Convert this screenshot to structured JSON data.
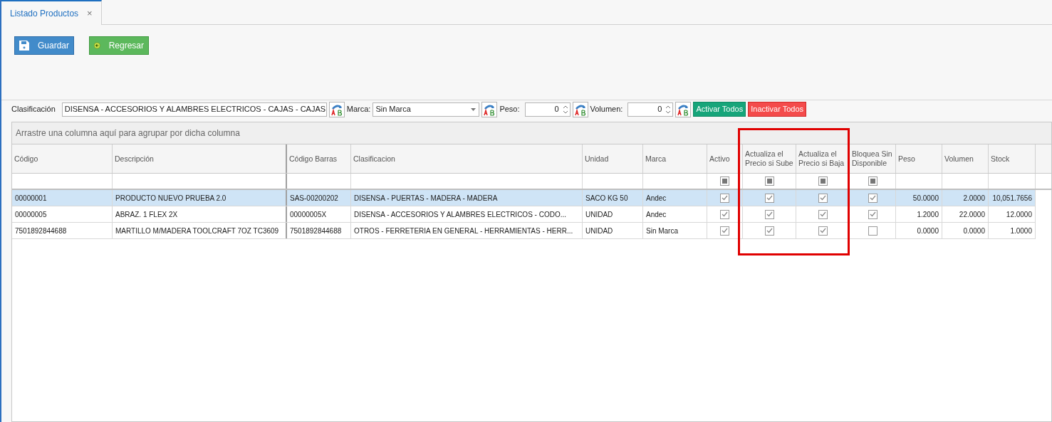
{
  "tabs": [
    {
      "label": "Listado Productos",
      "selected": true,
      "close": "×"
    }
  ],
  "toolbar": [
    {
      "label": "Guardar",
      "kind": "save"
    },
    {
      "label": "Regresar",
      "kind": "back"
    }
  ],
  "filters": {
    "clasificacion": {
      "label": "Clasificación",
      "value": "DISENSA - ACCESORIOS Y ALAMBRES ELECTRICOS - CAJAS - CAJAS"
    },
    "marca": {
      "label": "Marca:",
      "value": "Sin Marca"
    },
    "peso": {
      "label": "Peso:",
      "value": "0"
    },
    "volumen": {
      "label": "Volumen:",
      "value": "0"
    },
    "activate": "Activar Todos",
    "deactivate": "Inactivar Todos"
  },
  "group_panel": "Arrastre una columna aquí para agrupar por dicha columna",
  "columns": [
    {
      "label": "Código",
      "kind": "text"
    },
    {
      "label": "Descripción",
      "kind": "text"
    },
    {
      "label": "Código Barras",
      "kind": "text"
    },
    {
      "label": "Clasificacion",
      "kind": "text"
    },
    {
      "label": "Unidad",
      "kind": "text"
    },
    {
      "label": "Marca",
      "kind": "text"
    },
    {
      "label": "Activo",
      "kind": "check",
      "filter_indeterminate": true
    },
    {
      "label": "Actualiza el Precio si Sube",
      "kind": "check",
      "filter_indeterminate": true,
      "highlighted": true
    },
    {
      "label": "Actualiza el Precio si Baja",
      "kind": "check",
      "filter_indeterminate": true,
      "highlighted": true
    },
    {
      "label": "Bloquea Sin Disponible",
      "kind": "check",
      "filter_indeterminate": true
    },
    {
      "label": "Peso",
      "kind": "number"
    },
    {
      "label": "Volumen",
      "kind": "number"
    },
    {
      "label": "Stock",
      "kind": "number"
    }
  ],
  "rows": [
    {
      "selected": true,
      "cells": [
        "00000001",
        "PRODUCTO NUEVO PRUEBA 2.0",
        "SAS-00200202",
        "DISENSA - PUERTAS - MADERA - MADERA",
        "SACO KG 50",
        "Andec",
        true,
        true,
        true,
        true,
        "50.0000",
        "2.0000",
        "10,051.7656"
      ]
    },
    {
      "selected": false,
      "cells": [
        "00000005",
        "ABRAZ. 1 FLEX  2X",
        "00000005X",
        "DISENSA - ACCESORIOS Y ALAMBRES ELECTRICOS - CODO...",
        "UNIDAD",
        "Andec",
        true,
        true,
        true,
        true,
        "1.2000",
        "22.0000",
        "12.0000"
      ]
    },
    {
      "selected": false,
      "cells": [
        "7501892844688",
        "MARTILLO M/MADERA TOOLCRAFT 7OZ TC3609",
        "7501892844688",
        "OTROS - FERRETERIA EN GENERAL - HERRAMIENTAS - HERR...",
        "UNIDAD",
        "Sin Marca",
        true,
        true,
        true,
        false,
        "0.0000",
        "0.0000",
        "1.0000"
      ]
    }
  ]
}
